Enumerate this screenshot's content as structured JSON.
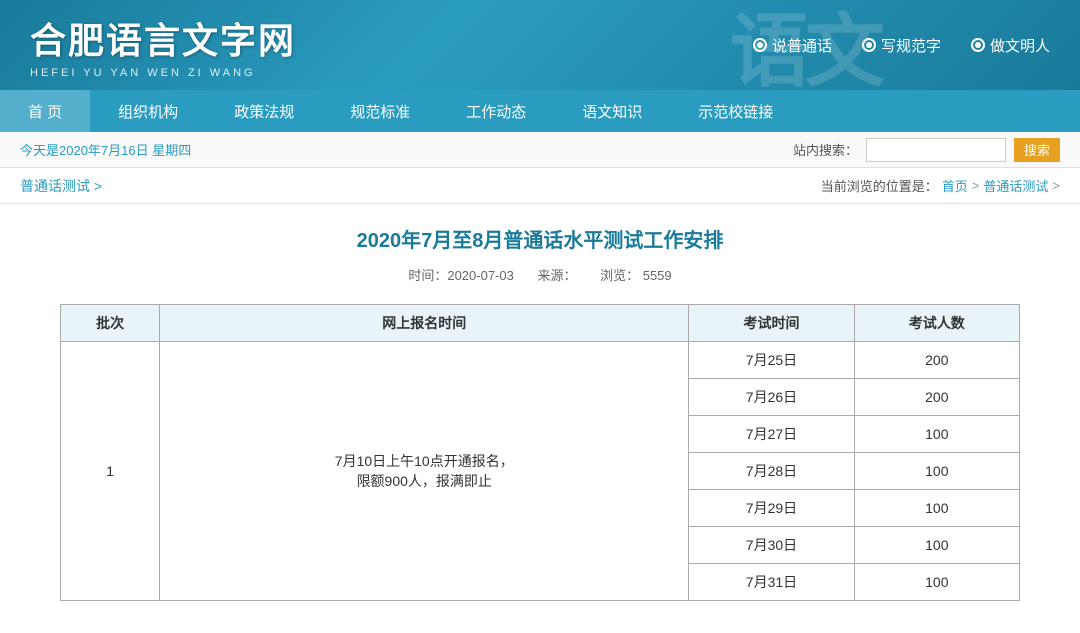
{
  "header": {
    "logo_main": "合肥语言文字网",
    "logo_sub": "HEFEI YU YAN WEN ZI WANG",
    "slogans": [
      {
        "text": "说普通话"
      },
      {
        "text": "写规范字"
      },
      {
        "text": "做文明人"
      }
    ]
  },
  "nav": {
    "items": [
      {
        "label": "首  页",
        "id": "home"
      },
      {
        "label": "组织机构",
        "id": "org"
      },
      {
        "label": "政策法规",
        "id": "policy"
      },
      {
        "label": "规范标准",
        "id": "standards"
      },
      {
        "label": "工作动态",
        "id": "news"
      },
      {
        "label": "语文知识",
        "id": "knowledge"
      },
      {
        "label": "示范校链接",
        "id": "schools"
      }
    ]
  },
  "toolbar": {
    "date_text": "今天是2020年7月16日   星期四",
    "search_label": "站内搜索：",
    "search_placeholder": "",
    "search_btn": "搜索"
  },
  "breadcrumb": {
    "left_text": "普通话测试 >",
    "current_label": "当前浏览的位置是：",
    "home_link": "首页",
    "sep1": ">",
    "section_link": "普通话测试",
    "sep2": ">"
  },
  "article": {
    "title": "2020年7月至8月普通话水平测试工作安排",
    "meta_time": "时间：2020-07-03",
    "meta_source": "来源：",
    "meta_views": "浏览：  5559",
    "table": {
      "headers": [
        "批次",
        "网上报名时间",
        "考试时间",
        "考试人数"
      ],
      "rows": [
        {
          "batch": "1",
          "reg_time": "7月10日上午10点开通报名，\n限额900人，报满即止",
          "exam_dates": [
            {
              "date": "7月25日",
              "count": "200"
            },
            {
              "date": "7月26日",
              "count": "200"
            },
            {
              "date": "7月27日",
              "count": "100"
            },
            {
              "date": "7月28日",
              "count": "100"
            },
            {
              "date": "7月29日",
              "count": "100"
            },
            {
              "date": "7月30日",
              "count": "100"
            },
            {
              "date": "7月31日",
              "count": "100"
            }
          ]
        }
      ]
    }
  }
}
